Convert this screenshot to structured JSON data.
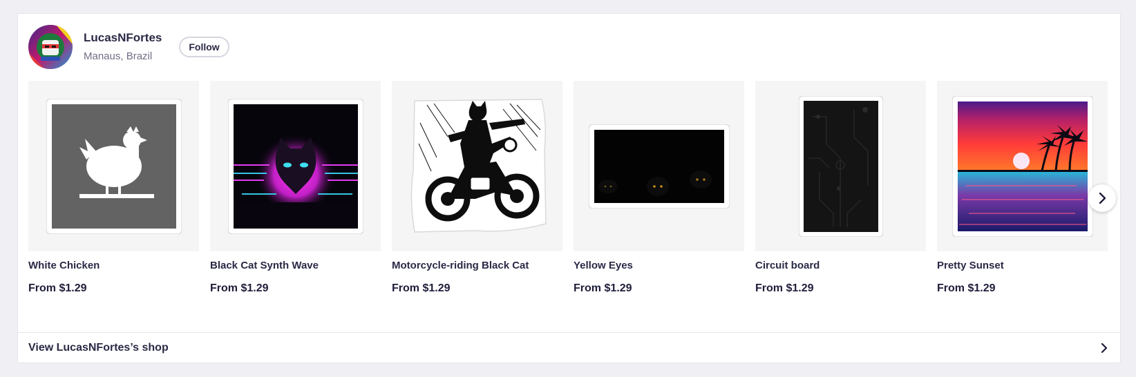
{
  "artist": {
    "name": "LucasNFortes",
    "location": "Manaus, Brazil",
    "follow_label": "Follow"
  },
  "products": [
    {
      "title": "White Chicken",
      "price": "From $1.29",
      "image": "white-chicken-sticker"
    },
    {
      "title": "Black Cat Synth Wave",
      "price": "From $1.29",
      "image": "black-cat-synthwave-sticker"
    },
    {
      "title": "Motorcycle-riding Black Cat",
      "price": "From $1.29",
      "image": "motorcycle-cat-sticker"
    },
    {
      "title": "Yellow Eyes",
      "price": "From $1.29",
      "image": "yellow-eyes-sticker"
    },
    {
      "title": "Circuit board",
      "price": "From $1.29",
      "image": "circuit-board-sticker"
    },
    {
      "title": "Pretty Sunset",
      "price": "From $1.29",
      "image": "pretty-sunset-sticker"
    }
  ],
  "footer": {
    "shop_link": "View LucasNFortes’s shop"
  },
  "icons": {
    "next": "chevron-right-icon",
    "footer_arrow": "chevron-right-icon"
  },
  "colors": {
    "text_primary": "#2a2946",
    "text_muted": "#706f87",
    "page_bg": "#f0f0f4"
  }
}
